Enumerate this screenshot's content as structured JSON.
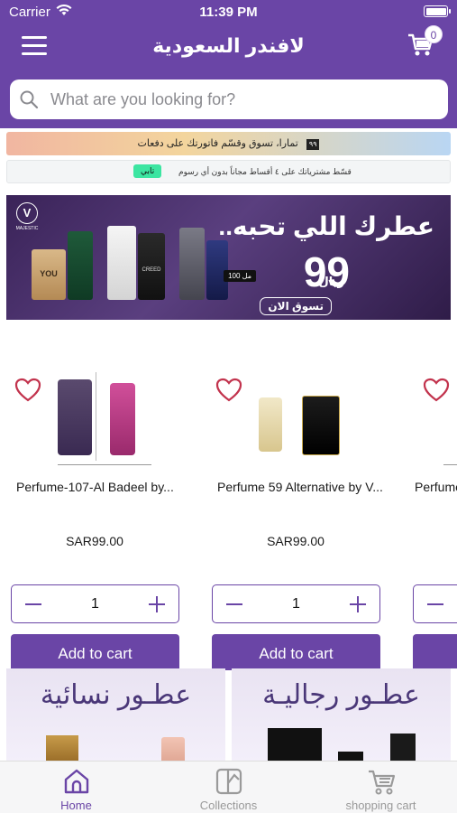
{
  "status_bar": {
    "carrier": "Carrier",
    "time": "11:39 PM"
  },
  "header": {
    "title": "لافندر السعودية",
    "cart_count": "0"
  },
  "search": {
    "placeholder": "What are you looking for?"
  },
  "promos": {
    "tamara_text": "تمارا، تسوق وقسّم فاتورتك على دفعات",
    "tamara_logo": "٩٩",
    "tabby_text": "قسّط مشترياتك على ٤ أقساط مجاناً بدون أي رسوم",
    "tabby_badge": "تابي"
  },
  "hero_banner": {
    "brand": "MAJESTIC",
    "headline": "عطرك اللي تحبه..",
    "price": "99",
    "currency": "ريال",
    "volume": "100 مل",
    "cta": "تسوق الان",
    "bottle_labels": [
      "YOU",
      "CREED"
    ]
  },
  "products": [
    {
      "name": "Perfume-107-Al Badeel by...",
      "price": "SAR99.00",
      "quantity": "1",
      "add_to_cart": "Add to cart"
    },
    {
      "name": "Perfume 59 Alternative by V...",
      "price": "SAR99.00",
      "quantity": "1",
      "add_to_cart": "Add to cart"
    },
    {
      "name": "Perfume",
      "price": "",
      "quantity": "",
      "add_to_cart": ""
    }
  ],
  "categories": [
    {
      "title": "عطـور نسائية"
    },
    {
      "title": "عطـور رجاليـة"
    }
  ],
  "tab_bar": {
    "items": [
      {
        "label": "Home",
        "icon": "home-icon",
        "active": true
      },
      {
        "label": "Collections",
        "icon": "collections-icon",
        "active": false
      },
      {
        "label": "shopping cart",
        "icon": "cart-icon",
        "active": false
      }
    ]
  },
  "colors": {
    "primary": "#6a45a6",
    "tab_inactive": "#9a9a9a",
    "heart": "#c2334d"
  }
}
